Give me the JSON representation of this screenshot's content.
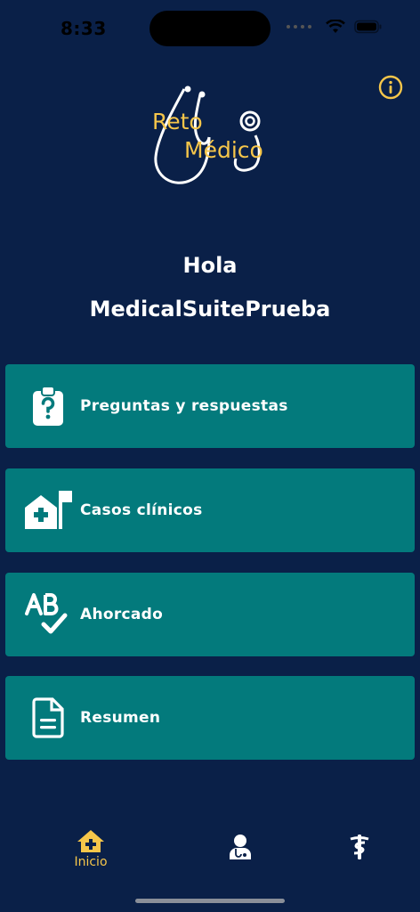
{
  "status": {
    "time": "8:33"
  },
  "logo": {
    "line1": "Reto",
    "line2": "Médico"
  },
  "greeting": {
    "hello": "Hola",
    "username": "MedicalSuitePrueba"
  },
  "menu": [
    {
      "label": "Preguntas y respuestas",
      "icon": "clipboard-question-icon"
    },
    {
      "label": "Casos clínicos",
      "icon": "hospital-icon"
    },
    {
      "label": "Ahorcado",
      "icon": "spell-check-icon"
    },
    {
      "label": "Resumen",
      "icon": "document-icon"
    }
  ],
  "tabs": [
    {
      "label": "Inicio",
      "icon": "home-medical-icon",
      "active": true
    },
    {
      "label": "",
      "icon": "doctor-icon",
      "active": false
    },
    {
      "label": "",
      "icon": "caduceus-icon",
      "active": false
    }
  ],
  "colors": {
    "background": "#0a2048",
    "card": "#037a7c",
    "accent": "#f6c64a"
  }
}
